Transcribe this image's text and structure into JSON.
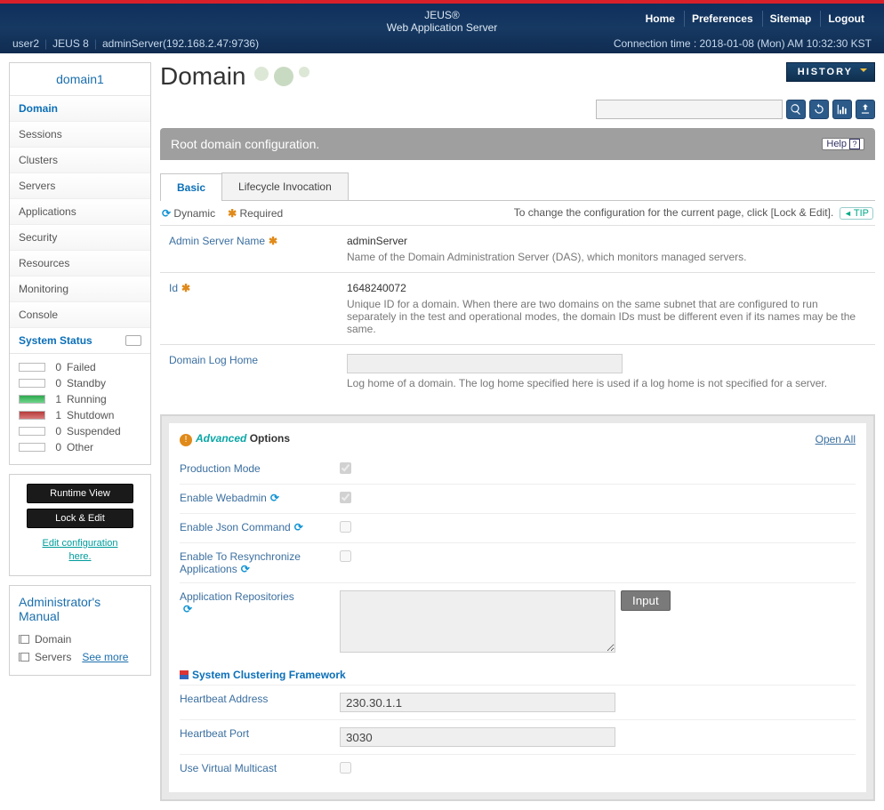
{
  "top": {
    "logo_main": "JEUS",
    "logo_reg": "®",
    "logo_sub": "Web Application Server",
    "nav": {
      "home": "Home",
      "preferences": "Preferences",
      "sitemap": "Sitemap",
      "logout": "Logout"
    },
    "user": "user2",
    "product": "JEUS 8",
    "server": "adminServer(192.168.2.47:9736)",
    "conn_label": "Connection time :",
    "conn_value": "2018-01-08 (Mon) AM 10:32:30 KST"
  },
  "sidebar": {
    "domain_title": "domain1",
    "nav": [
      "Domain",
      "Sessions",
      "Clusters",
      "Servers",
      "Applications",
      "Security",
      "Resources",
      "Monitoring",
      "Console"
    ],
    "status_header": "System Status",
    "status": [
      {
        "swatch": "blank",
        "count": "0",
        "label": "Failed"
      },
      {
        "swatch": "blank",
        "count": "0",
        "label": "Standby"
      },
      {
        "swatch": "green",
        "count": "1",
        "label": "Running"
      },
      {
        "swatch": "red",
        "count": "1",
        "label": "Shutdown"
      },
      {
        "swatch": "blank",
        "count": "0",
        "label": "Suspended"
      },
      {
        "swatch": "blank",
        "count": "0",
        "label": "Other"
      }
    ],
    "btn_runtime": "Runtime View",
    "btn_lockedit": "Lock & Edit",
    "edit_link1": "Edit configuration",
    "edit_link2": "here.",
    "manual_title": "Administrator's Manual",
    "manual_items": [
      "Domain",
      "Servers"
    ],
    "see_more": "See more"
  },
  "main": {
    "title": "Domain",
    "history": "HISTORY",
    "search_placeholder": "",
    "banner": "Root domain configuration.",
    "help": "Help",
    "tabs": {
      "basic": "Basic",
      "lifecycle": "Lifecycle Invocation"
    },
    "legend": {
      "dynamic": "Dynamic",
      "required": "Required",
      "hint": "To change the configuration for the current page, click [Lock & Edit].",
      "tip": "TIP"
    },
    "fields": {
      "admin_name_label": "Admin Server Name",
      "admin_name_value": "adminServer",
      "admin_name_desc": "Name of the Domain Administration Server (DAS), which monitors managed servers.",
      "id_label": "Id",
      "id_value": "1648240072",
      "id_desc": "Unique ID for a domain. When there are two domains on the same subnet that are configured to run separately in the test and operational modes, the domain IDs must be different even if its names may be the same.",
      "loghome_label": "Domain Log Home",
      "loghome_desc": "Log home of a domain. The log home specified here is used if a log home is not specified for a server."
    },
    "adv": {
      "title1": "Advanced",
      "title2": "Options",
      "openall": "Open All",
      "production_mode": "Production Mode",
      "enable_webadmin": "Enable Webadmin",
      "enable_json": "Enable Json Command",
      "enable_resync": "Enable To Resynchronize Applications",
      "app_repos": "Application Repositories",
      "input_btn": "Input",
      "clustering_header": "System Clustering Framework",
      "hb_addr_label": "Heartbeat Address",
      "hb_addr_value": "230.30.1.1",
      "hb_port_label": "Heartbeat Port",
      "hb_port_value": "3030",
      "virt_multi_label": "Use Virtual Multicast"
    }
  }
}
